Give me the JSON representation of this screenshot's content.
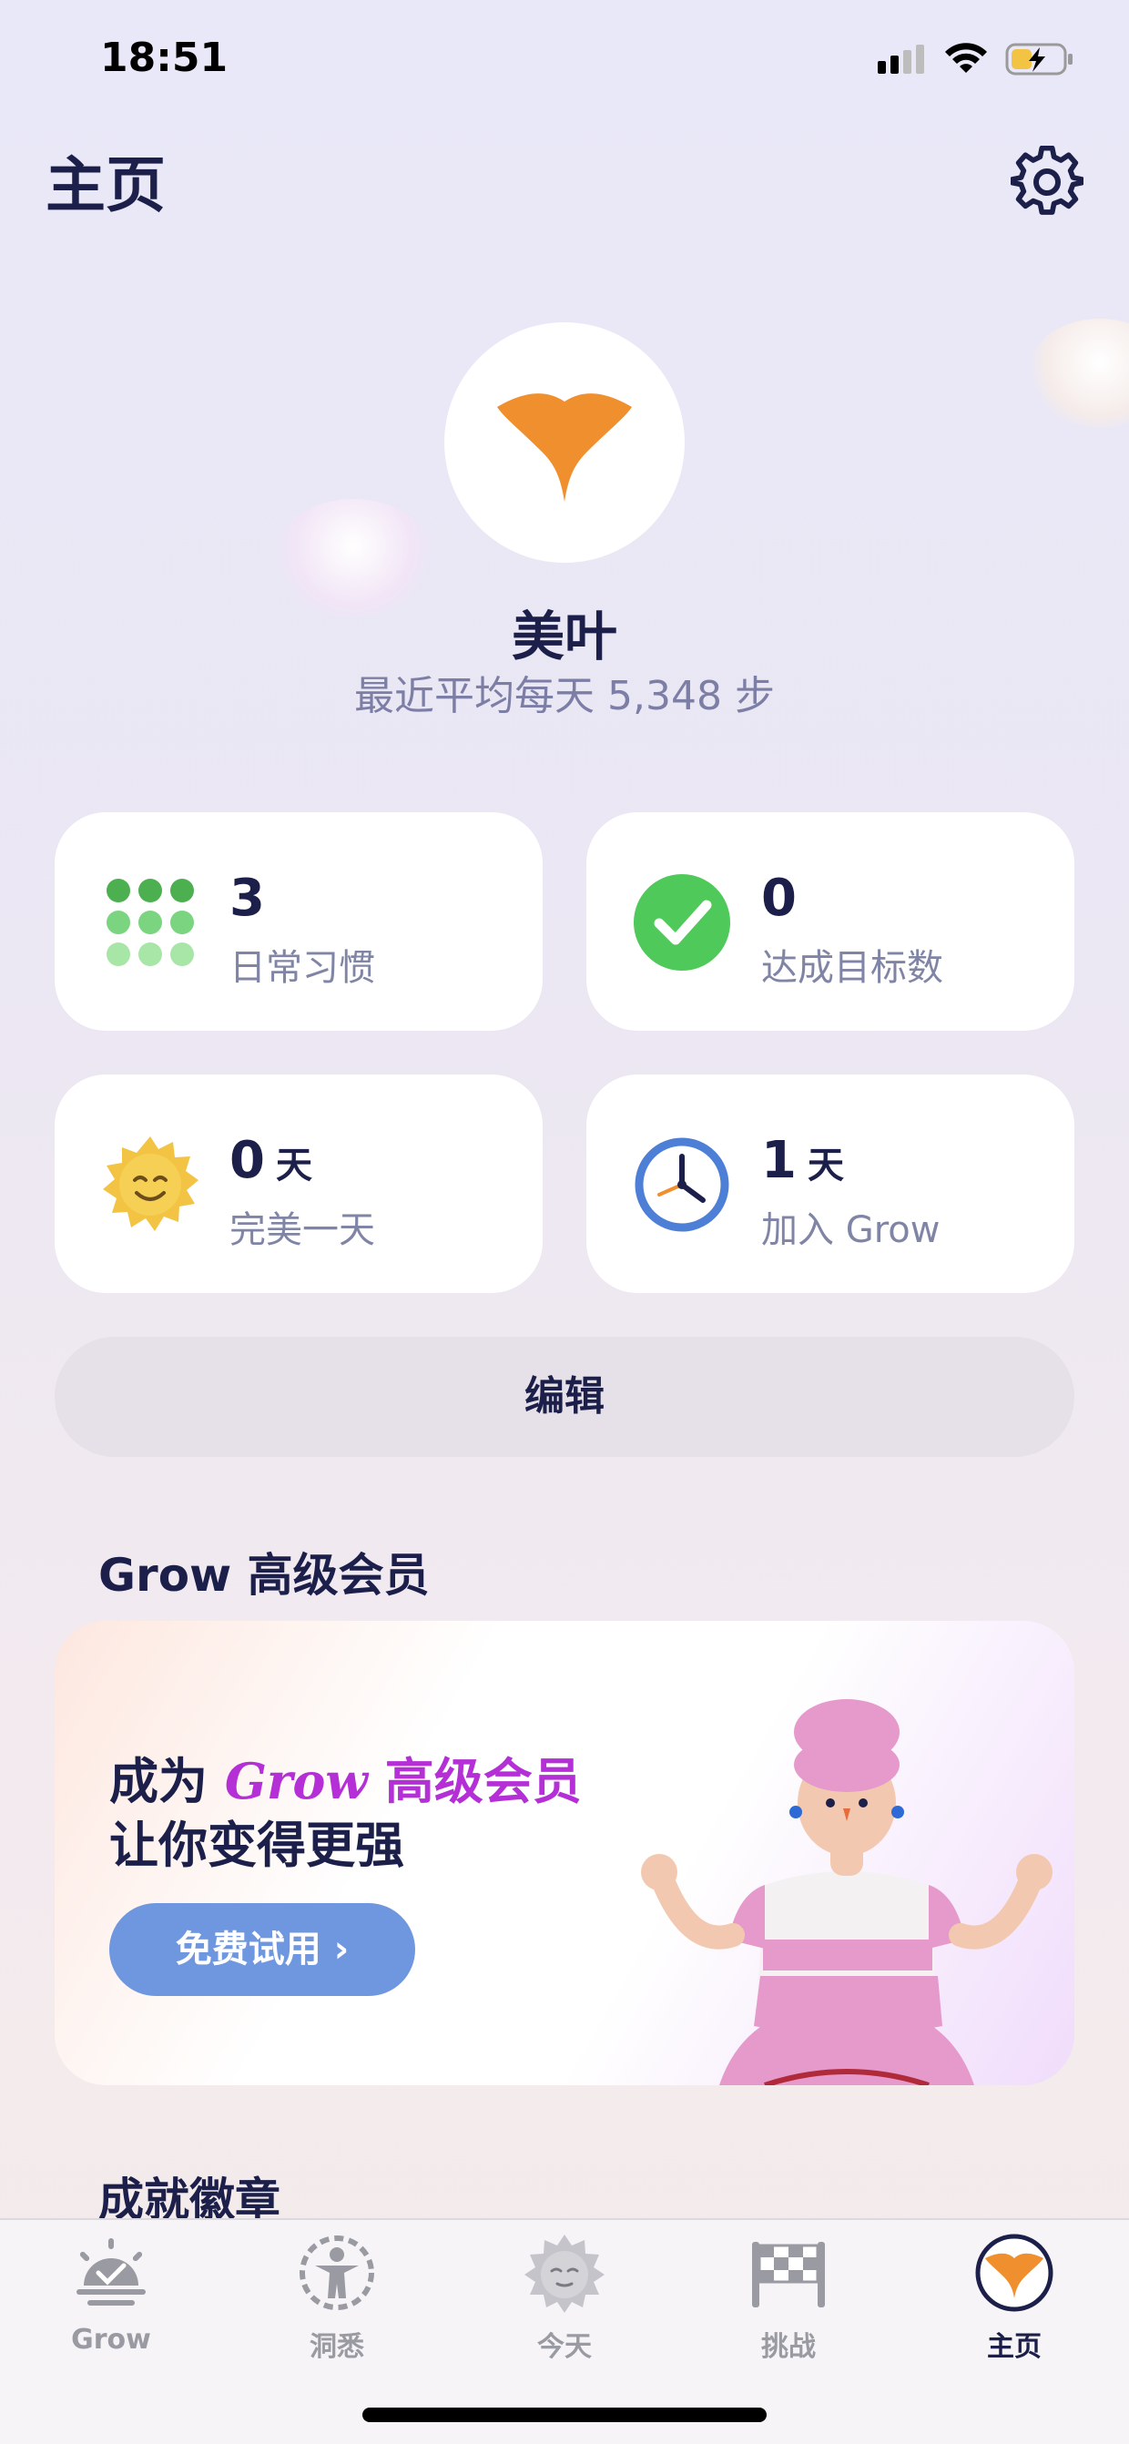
{
  "status_bar": {
    "time": "18:51"
  },
  "header": {
    "title": "主页"
  },
  "profile": {
    "name": "美叶",
    "subtitle": "最近平均每天 5,348 步"
  },
  "stats": [
    {
      "value": "3",
      "unit": "",
      "label": "日常习惯",
      "icon": "dots-grid-icon"
    },
    {
      "value": "0",
      "unit": "",
      "label": "达成目标数",
      "icon": "check-circle-icon"
    },
    {
      "value": "0",
      "unit": "天",
      "label": "完美一天",
      "icon": "smiling-sun-icon"
    },
    {
      "value": "1",
      "unit": "天",
      "label": "加入 Grow",
      "icon": "clock-icon"
    }
  ],
  "edit_button": "编辑",
  "premium": {
    "section_title": "Grow 高级会员",
    "line1_prefix": "成为",
    "line1_brand": "Grow",
    "line1_suffix": "高级会员",
    "line2": "让你变得更强",
    "cta": "免费试用 ›"
  },
  "badges": {
    "section_title": "成就徽章"
  },
  "tabs": [
    {
      "label": "Grow",
      "icon": "sunrise-icon",
      "active": false
    },
    {
      "label": "洞悉",
      "icon": "body-icon",
      "active": false
    },
    {
      "label": "今天",
      "icon": "sun-face-icon",
      "active": false
    },
    {
      "label": "挑战",
      "icon": "checkered-flag-icon",
      "active": false
    },
    {
      "label": "主页",
      "icon": "ginkgo-leaf-icon",
      "active": true
    }
  ],
  "colors": {
    "accent": "#f08f2e",
    "primary_text": "#1b1f4a",
    "secondary_text": "#8085a6",
    "premium": "#b42fd6",
    "cta": "#6f97e0",
    "check_green": "#4fc95a"
  }
}
